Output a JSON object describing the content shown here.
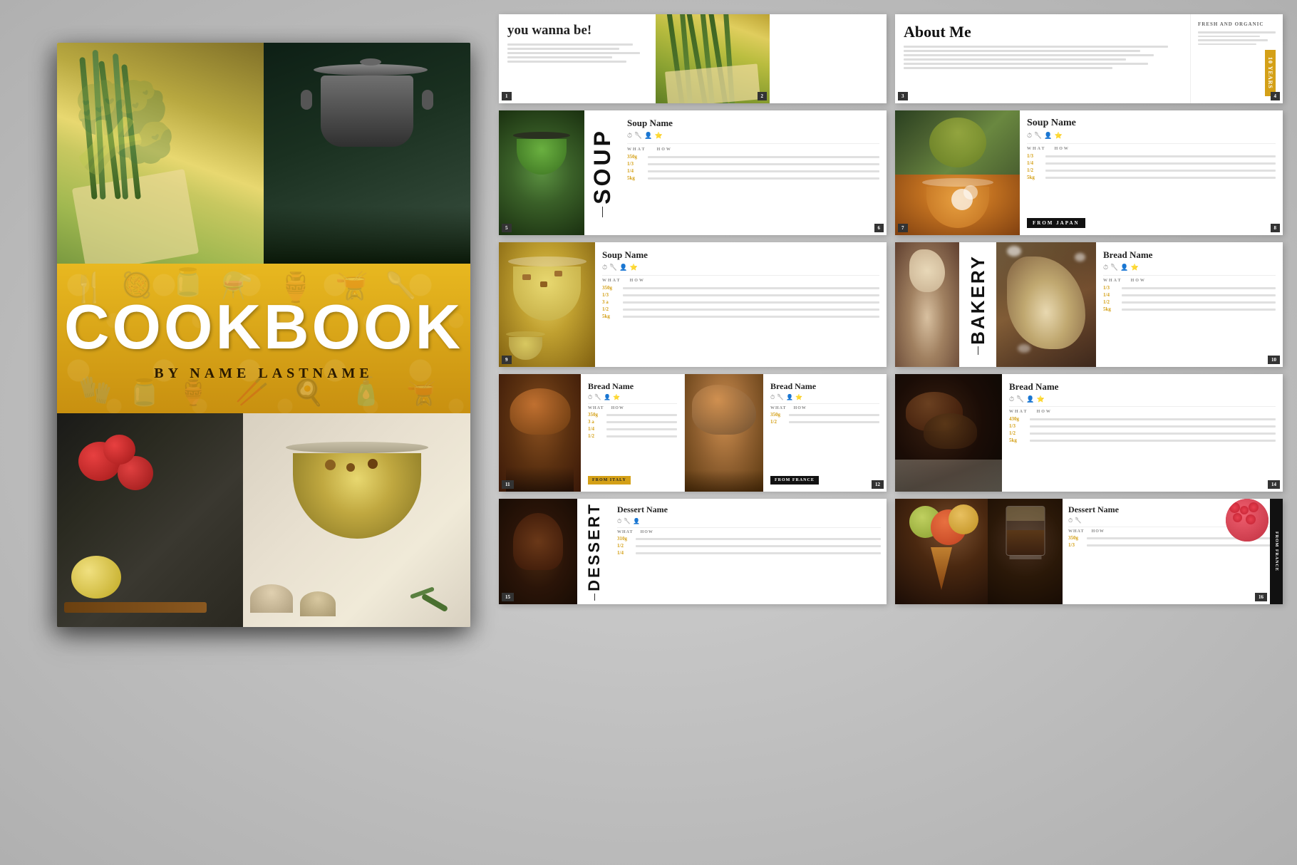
{
  "cover": {
    "title": "COOKBOOK",
    "subtitle": "BY NAME LASTNAME",
    "bg_color": "#d4a017"
  },
  "spreads": {
    "spread1": {
      "intro_title": "you wanna be!",
      "about_me_title": "About Me",
      "fresh_organic": "FRESH AND ORGANIC",
      "years_badge": "10 YEARS"
    },
    "spread2": {
      "category": "SOUP",
      "recipe_name_1": "Soup Name",
      "recipe_name_2": "Soup Name",
      "what_label": "WHAT",
      "how_label": "HOW",
      "origin": "FROM JAPAN"
    },
    "spread3": {
      "category": "BAKERY",
      "recipe_name_1": "Soup Name",
      "recipe_name_2": "Bread Name",
      "what_label": "WHAT",
      "how_label": "HOW"
    },
    "spread4": {
      "recipe_name_1": "Bread Name",
      "recipe_name_2": "Bread Name",
      "recipe_name_3": "Bread Name",
      "from_1": "FROM ITALY",
      "from_2": "FROM FRANCE"
    },
    "spread5": {
      "category": "DESSERT",
      "recipe_name_1": "Dessert Name",
      "recipe_name_2": "Dessert Name",
      "from": "FROM FRANCE"
    }
  },
  "ingredients": {
    "line1": "350g",
    "line2": "1/3",
    "line3": "3 a",
    "line4": "1/4",
    "line5": "1/2",
    "line6": "5kg"
  },
  "page_numbers": {
    "p1": "1",
    "p2": "2",
    "p3": "3",
    "p4": "4",
    "p5": "5",
    "p6": "6",
    "p7": "7",
    "p8": "8",
    "p9": "9",
    "p10": "10"
  }
}
